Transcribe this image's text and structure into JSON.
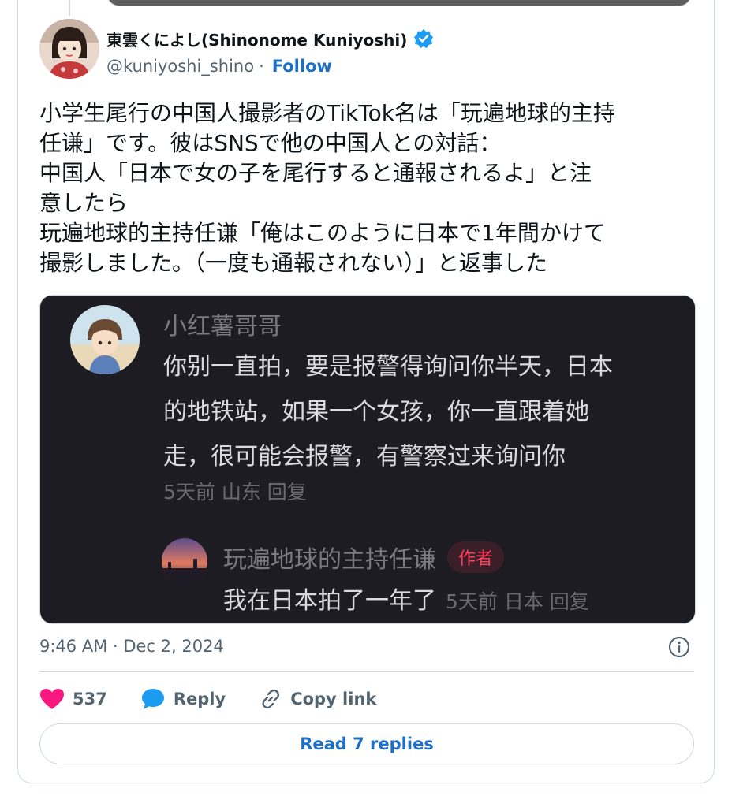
{
  "author": {
    "display_name": "東雲くによし(Shinonome Kuniyoshi)",
    "handle": "@kuniyoshi_shino",
    "separator": "·",
    "follow_label": "Follow"
  },
  "tweet_text_lines": [
    "小学生尾行の中国人撮影者のTikTok名は「玩遍地球的主持",
    "任谦」です。彼はSNSで他の中国人との対話：",
    "中国人「日本で女の子を尾行すると通報されるよ」と注",
    "意したら",
    "玩遍地球的主持任谦「俺はこのように日本で1年間かけて",
    "撮影しました。（一度も通報されない）」と返事した"
  ],
  "embedded_screenshot": {
    "comment": {
      "username": "小红薯哥哥",
      "text_lines": [
        "你别一直拍，要是报警得询问你半天，日本",
        "的地铁站，如果一个女孩，你一直跟着她",
        "走，很可能会报警，有警察过来询问你"
      ],
      "meta": "5天前 山东 回复"
    },
    "reply": {
      "username": "玩遍地球的主持任谦",
      "badge": "作者",
      "text": "我在日本拍了一年了",
      "meta": "5天前 日本 回复"
    }
  },
  "timestamp": "9:46 AM · Dec 2, 2024",
  "actions": {
    "like_count": "537",
    "reply_label": "Reply",
    "copy_link_label": "Copy link"
  },
  "read_replies_label": "Read 7 replies",
  "colors": {
    "accent": "#1d9bf0",
    "like": "#f91880",
    "embed_bg": "#1d1c23",
    "author_badge": "#ff3d5a"
  }
}
